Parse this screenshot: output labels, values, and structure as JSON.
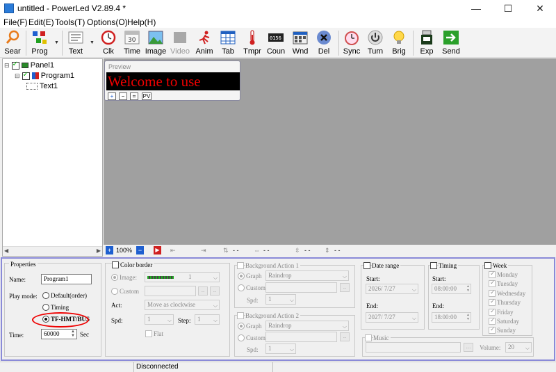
{
  "window": {
    "title": "untitled - PowerLed V2.89.4 *",
    "minimize": "—",
    "maximize": "☐",
    "close": "✕"
  },
  "menu": [
    "File(F)",
    "Edit(E)",
    "Tools(T)",
    "Options(O)",
    "Help(H)"
  ],
  "toolbar": [
    {
      "label": "Sear",
      "icon": "search-icon"
    },
    {
      "label": "Prog",
      "icon": "program-icon"
    },
    {
      "label": "Text",
      "icon": "text-icon"
    },
    {
      "label": "Clk",
      "icon": "clock-icon"
    },
    {
      "label": "Time",
      "icon": "calendar-icon"
    },
    {
      "label": "Image",
      "icon": "image-icon"
    },
    {
      "label": "Video",
      "icon": "video-icon",
      "disabled": true
    },
    {
      "label": "Anim",
      "icon": "animation-icon"
    },
    {
      "label": "Tab",
      "icon": "table-icon"
    },
    {
      "label": "Tmpr",
      "icon": "thermometer-icon"
    },
    {
      "label": "Coun",
      "icon": "counter-icon"
    },
    {
      "label": "Wnd",
      "icon": "window-icon"
    },
    {
      "label": "Del",
      "icon": "delete-icon"
    },
    {
      "label": "Sync",
      "icon": "sync-clock-icon"
    },
    {
      "label": "Turn",
      "icon": "power-icon"
    },
    {
      "label": "Brig",
      "icon": "bulb-icon"
    },
    {
      "label": "Exp",
      "icon": "usb-icon"
    },
    {
      "label": "Send",
      "icon": "send-arrow-icon"
    }
  ],
  "tree": {
    "panel": "Panel1",
    "program": "Program1",
    "text": "Text1"
  },
  "preview": {
    "header": "Preview",
    "led_text": "Welcome to use",
    "btn_plus": "+",
    "btn_minus": "−",
    "btn_fit": "⌗",
    "btn_pv": "PV"
  },
  "canvas_bar": {
    "zoom": "100%",
    "x": "- -",
    "w": "- -",
    "y": "- -",
    "h": "- -"
  },
  "properties": {
    "title": "Properties",
    "name_label": "Name:",
    "name_value": "Program1",
    "play_mode_label": "Play mode:",
    "modes": [
      "Default(order)",
      "Timing",
      "TF-HMT/BUS"
    ],
    "time_label": "Time:",
    "time_value": "60000",
    "time_unit": "Sec"
  },
  "color_border": {
    "title": "Color border",
    "image_label": "Image:",
    "image_value": "1",
    "custom_label": "Custom",
    "act_label": "Act:",
    "act_value": "Move as clockwise",
    "spd_label": "Spd:",
    "spd_value": "1",
    "step_label": "Step:",
    "step_value": "1",
    "flat_label": "Flat"
  },
  "bg_action1": {
    "title": "Background Action 1",
    "graph_label": "Graph",
    "graph_value": "Raindrop",
    "custom_label": "Custom",
    "spd_label": "Spd:",
    "spd_value": "1"
  },
  "bg_action2": {
    "title": "Background Action 2",
    "graph_label": "Graph",
    "graph_value": "Raindrop",
    "custom_label": "Custom",
    "spd_label": "Spd:",
    "spd_value": "1"
  },
  "date_range": {
    "title": "Date range",
    "start_label": "Start:",
    "start_value": "2026/ 7/27",
    "end_label": "End:",
    "end_value": "2027/ 7/27"
  },
  "timing": {
    "title": "Timing",
    "start_label": "Start:",
    "start_value": "08:00:00",
    "end_label": "End:",
    "end_value": "18:00:00"
  },
  "week": {
    "title": "Week",
    "days": [
      "Monday",
      "Tuesday",
      "Wednesday",
      "Thursday",
      "Friday",
      "Saturday",
      "Sunday"
    ]
  },
  "music": {
    "title": "Music",
    "volume_label": "Volume:",
    "volume_value": "20",
    "browse": "..."
  },
  "status": {
    "text": "Disconnected"
  }
}
